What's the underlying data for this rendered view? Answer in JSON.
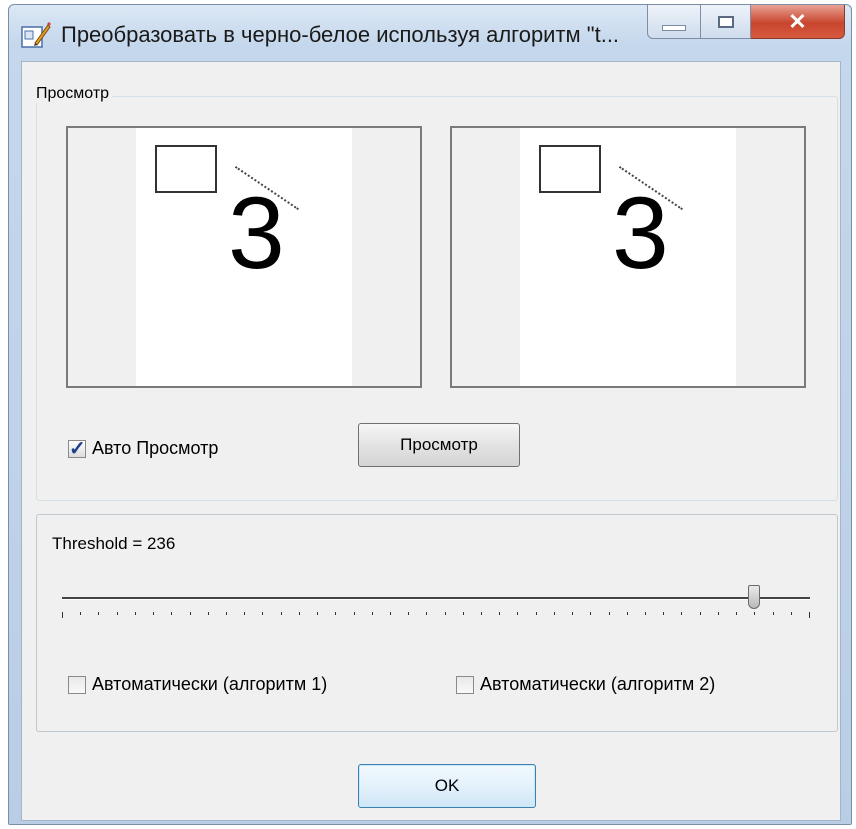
{
  "window": {
    "title": "Преобразовать в черно-белое используя алгоритм \"t...",
    "icon": "pencil-edit-icon",
    "controls": {
      "minimize": "minimize-icon",
      "maximize": "maximize-icon",
      "close": "✕"
    }
  },
  "preview_group": {
    "label": "Просмотр",
    "left_image": {
      "digit": "3"
    },
    "right_image": {
      "digit": "3"
    },
    "auto_preview": {
      "label": "Авто Просмотр",
      "checked": true
    },
    "preview_button": "Просмотр"
  },
  "threshold_group": {
    "label": "Threshold = 236",
    "slider": {
      "value": 236,
      "min": 0,
      "max": 255,
      "tick_count": 42
    },
    "auto1": {
      "label": "Автоматически (алгоритм 1)",
      "checked": false
    },
    "auto2": {
      "label": "Автоматически (алгоритм 2)",
      "checked": false
    }
  },
  "footer": {
    "ok_label": "OK"
  },
  "colors": {
    "titlebar": "#c5d7ec",
    "close": "#c8452e",
    "client": "#f0f0f0"
  }
}
